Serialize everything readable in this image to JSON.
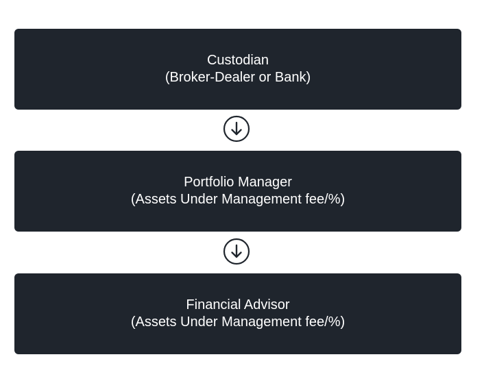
{
  "diagram": {
    "nodes": [
      {
        "title": "Custodian",
        "subtitle": "(Broker-Dealer or Bank)"
      },
      {
        "title": "Portfolio Manager",
        "subtitle": "(Assets Under Management fee/%)"
      },
      {
        "title": "Financial Advisor",
        "subtitle": "(Assets Under Management fee/%)"
      }
    ],
    "connector_icon": "arrow-down-circle-icon",
    "colors": {
      "node_background": "#1f252d",
      "node_text": "#ffffff",
      "connector": "#1f252d",
      "page_background": "#ffffff"
    }
  }
}
